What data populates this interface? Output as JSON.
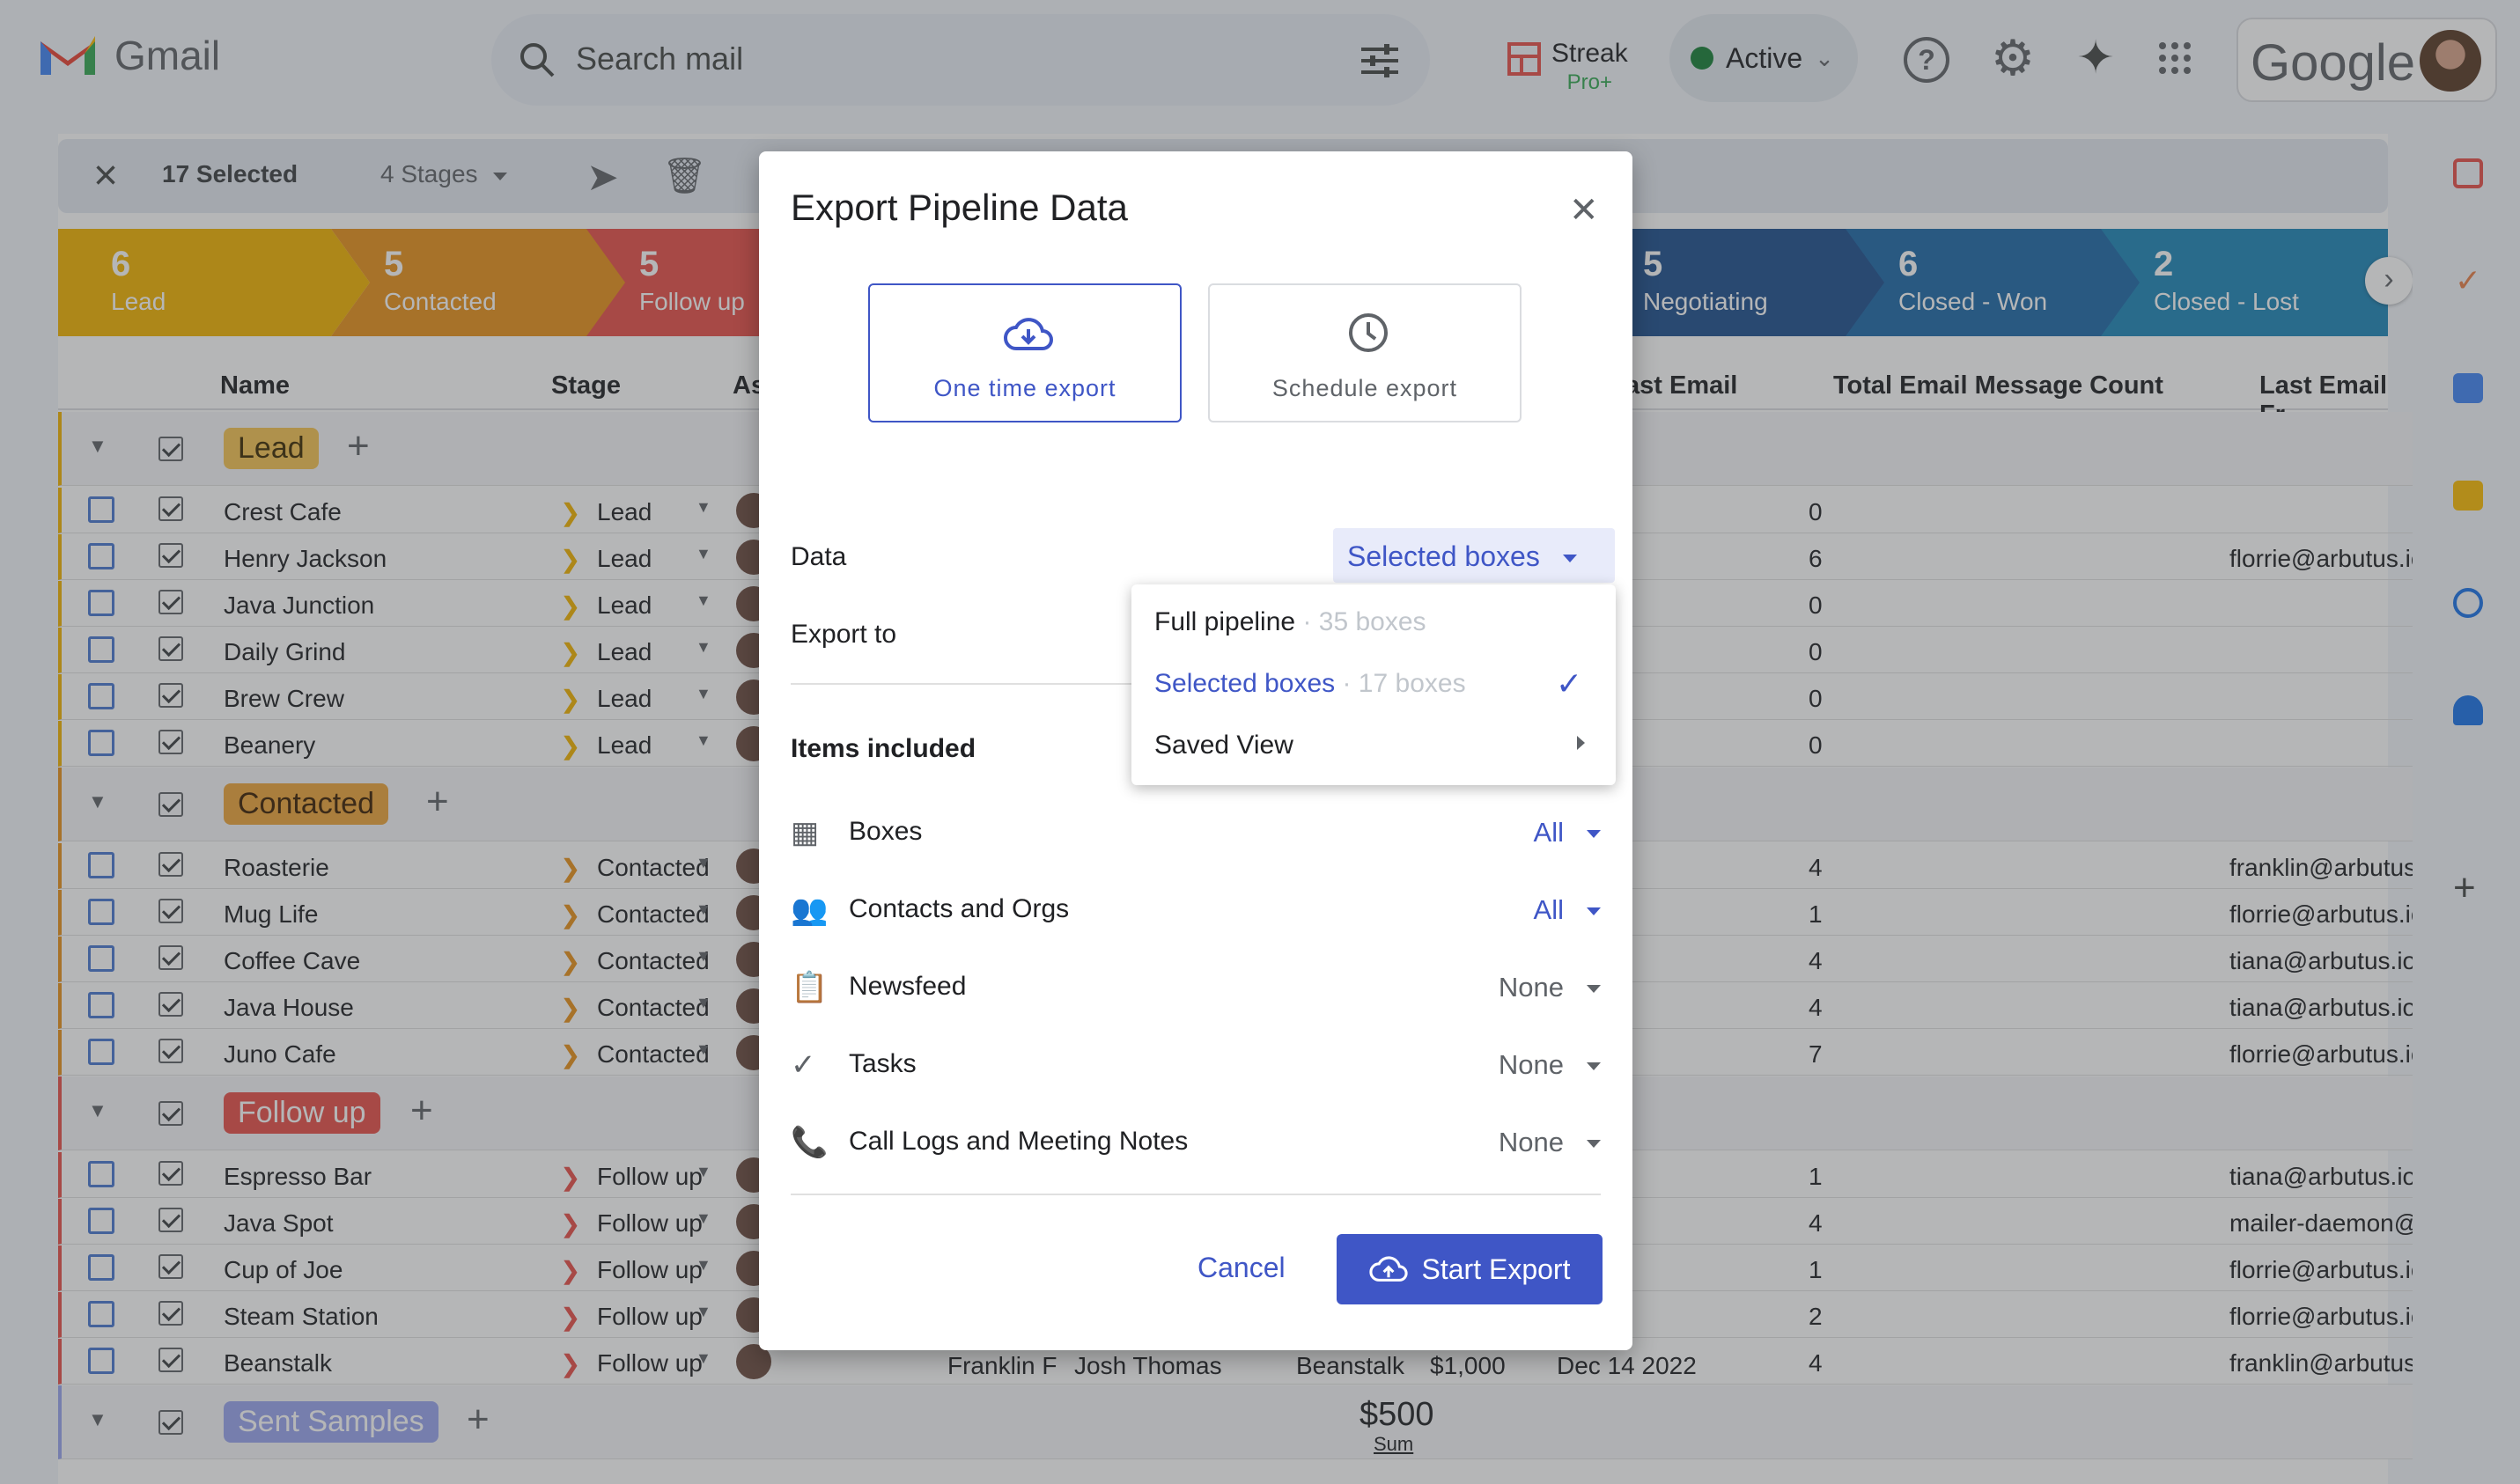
{
  "header": {
    "app_name": "Gmail",
    "search_placeholder": "Search mail",
    "streak_label": "Streak",
    "streak_plan": "Pro+",
    "status": "Active",
    "account_logo": "Google"
  },
  "toolbar": {
    "selected": "17 Selected",
    "stages": "4 Stages"
  },
  "stages": [
    {
      "count": "6",
      "label": "Lead",
      "color": "#f2b300"
    },
    {
      "count": "5",
      "label": "Contacted",
      "color": "#e8911a"
    },
    {
      "count": "5",
      "label": "Follow up",
      "color": "#e8504a"
    },
    {
      "count": "5",
      "label": "Negotiating",
      "color": "#1e4f8f"
    },
    {
      "count": "6",
      "label": "Closed - Won",
      "color": "#1e6aa8"
    },
    {
      "count": "2",
      "label": "Closed - Lost",
      "color": "#1e86b8"
    }
  ],
  "columns": {
    "name": "Name",
    "stage": "Stage",
    "assigned": "As",
    "last_email": "ast Email",
    "count": "Total Email Message Count",
    "last_from": "Last Email Fr"
  },
  "groups": [
    {
      "label": "Lead",
      "bg": "#f5c453",
      "fg": "#3c2a00",
      "rows": [
        {
          "name": "Crest Cafe",
          "stage": "Lead",
          "count": "0",
          "from": ""
        },
        {
          "name": "Henry Jackson",
          "stage": "Lead",
          "count": "6",
          "from": "florrie@arbutus.io"
        },
        {
          "name": "Java Junction",
          "stage": "Lead",
          "count": "0",
          "from": ""
        },
        {
          "name": "Daily Grind",
          "stage": "Lead",
          "count": "0",
          "from": ""
        },
        {
          "name": "Brew Crew",
          "stage": "Lead",
          "count": "0",
          "from": ""
        },
        {
          "name": "Beanery",
          "stage": "Lead",
          "count": "0",
          "from": ""
        }
      ]
    },
    {
      "label": "Contacted",
      "bg": "#eea53a",
      "fg": "#3c2000",
      "rows": [
        {
          "name": "Roasterie",
          "stage": "Contacted",
          "count": "4",
          "from": "franklin@arbutus"
        },
        {
          "name": "Mug Life",
          "stage": "Contacted",
          "count": "1",
          "from": "florrie@arbutus.io"
        },
        {
          "name": "Coffee Cave",
          "stage": "Contacted",
          "count": "4",
          "from": "tiana@arbutus.io"
        },
        {
          "name": "Java House",
          "stage": "Contacted",
          "count": "4",
          "from": "tiana@arbutus.io"
        },
        {
          "name": "Juno Cafe",
          "stage": "Contacted",
          "count": "7",
          "from": "florrie@arbutus.io"
        }
      ]
    },
    {
      "label": "Follow up",
      "bg": "#e8504a",
      "fg": "#ffffff",
      "rows": [
        {
          "name": "Espresso Bar",
          "stage": "Follow up",
          "count": "1",
          "from": "tiana@arbutus.io"
        },
        {
          "name": "Java Spot",
          "stage": "Follow up",
          "count": "4",
          "from": "mailer-daemon@"
        },
        {
          "name": "Cup of Joe",
          "stage": "Follow up",
          "count": "1",
          "from": "florrie@arbutus.io"
        },
        {
          "name": "Steam Station",
          "stage": "Follow up",
          "count": "2",
          "from": "florrie@arbutus.io"
        },
        {
          "name": "Beanstalk",
          "stage": "Follow up",
          "count": "4",
          "from": "franklin@arbutus"
        }
      ]
    },
    {
      "label": "Sent Samples",
      "bg": "#9aa5ef",
      "fg": "#ffffff",
      "rows": []
    }
  ],
  "beanstalk_extra": {
    "assignee": "Franklin F",
    "contact": "Josh Thomas",
    "org": "Beanstalk",
    "value": "$1,000",
    "date": "Dec 14 2022"
  },
  "sum": {
    "value": "$500",
    "label": "Sum"
  },
  "dialog": {
    "title": "Export Pipeline Data",
    "options": [
      "One time export",
      "Schedule export"
    ],
    "data_label": "Data",
    "data_value": "Selected boxes",
    "export_to_label": "Export to",
    "items_heading": "Items included",
    "items": [
      {
        "label": "Boxes",
        "value": "All",
        "active": true
      },
      {
        "label": "Contacts and Orgs",
        "value": "All",
        "active": true
      },
      {
        "label": "Newsfeed",
        "value": "None",
        "active": false
      },
      {
        "label": "Tasks",
        "value": "None",
        "active": false
      },
      {
        "label": "Call Logs and Meeting Notes",
        "value": "None",
        "active": false
      }
    ],
    "cancel": "Cancel",
    "start": "Start Export"
  },
  "menu": {
    "items": [
      {
        "label": "Full pipeline",
        "sub": "· 35 boxes"
      },
      {
        "label": "Selected boxes",
        "sub": "· 17 boxes"
      },
      {
        "label": "Saved View",
        "sub": ""
      }
    ]
  },
  "colors": {
    "accent": "#3f56c6",
    "overlay": "rgba(60,64,67,0.38)"
  }
}
